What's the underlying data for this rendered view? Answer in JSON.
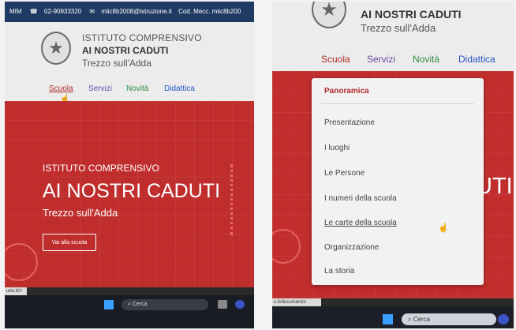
{
  "left": {
    "topbar": {
      "label": "MIM",
      "phone": "02-90933320",
      "email": "miic8b2008@istruzione.it",
      "code": "Cod. Mecc. miic8b200"
    },
    "header": {
      "line1": "ISTITUTO COMPRENSIVO",
      "line2": "AI NOSTRI CADUTI",
      "line3": "Trezzo sull'Adda"
    },
    "nav": [
      "Scuola",
      "Servizi",
      "Novità",
      "Didattica"
    ],
    "hero": {
      "kicker": "ISTITUTO COMPRENSIVO",
      "title": "AI NOSTRI CADUTI",
      "subtitle": "Trezzo sull'Adda",
      "button": "Vai alla scuola"
    },
    "status_url": "udu.it/#",
    "taskbar": {
      "search": "Cerca"
    }
  },
  "right": {
    "header": {
      "line2": "AI NOSTRI CADUTI",
      "line3": "Trezzo sull'Adda"
    },
    "nav": [
      "Scuola",
      "Servizi",
      "Novità",
      "Didattica"
    ],
    "hero_fragment": "UTI",
    "dropdown": {
      "heading": "Panoramica",
      "items": [
        "Presentazione",
        "I luoghi",
        "Le Persone",
        "I numeri della scuola",
        "Le carte della scuola",
        "Organizzazione",
        "La storia"
      ]
    },
    "status_url": "u.it/documento/",
    "taskbar": {
      "search": "Cerca"
    }
  },
  "colors": {
    "topbar": "#1f3b63",
    "hero_red": "#c02d2d",
    "nav_scuola": "#b22b2b",
    "nav_servizi": "#6a4aa8",
    "nav_novita": "#2e8a3e",
    "nav_didattica": "#2a55c9"
  }
}
